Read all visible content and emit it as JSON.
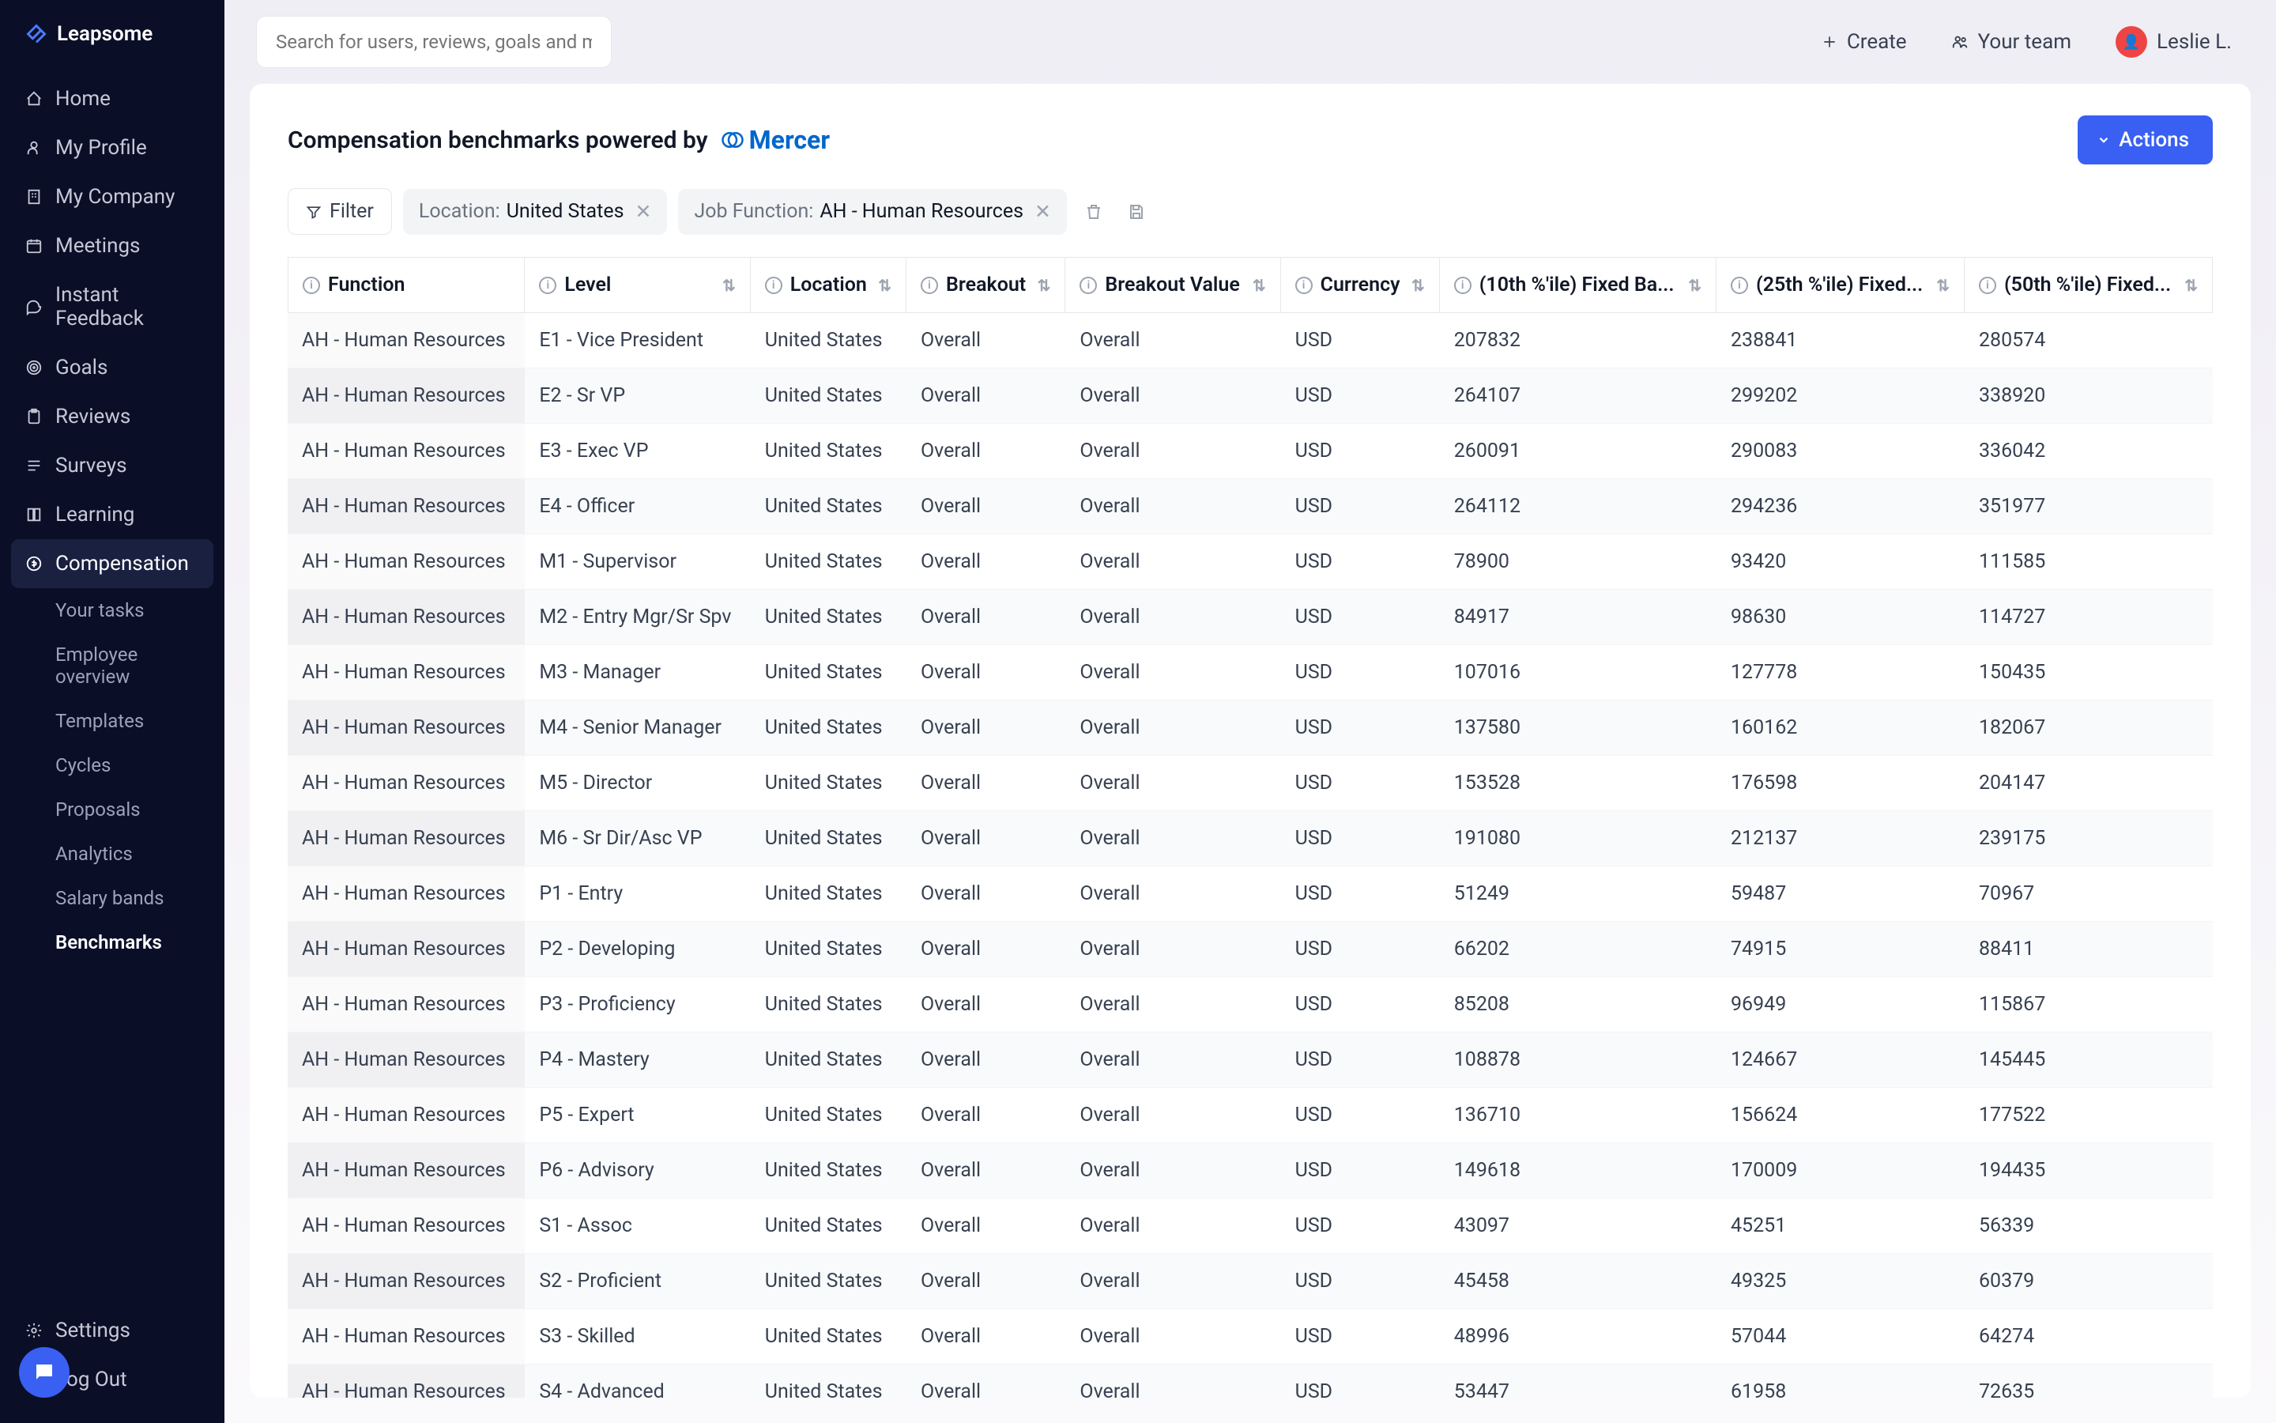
{
  "brand": "Leapsome",
  "search": {
    "placeholder": "Search for users, reviews, goals and meetings"
  },
  "topbar": {
    "create": "Create",
    "your_team": "Your team",
    "user_name": "Leslie L."
  },
  "sidebar": {
    "items": [
      {
        "label": "Home"
      },
      {
        "label": "My Profile"
      },
      {
        "label": "My Company"
      },
      {
        "label": "Meetings"
      },
      {
        "label": "Instant Feedback"
      },
      {
        "label": "Goals"
      },
      {
        "label": "Reviews"
      },
      {
        "label": "Surveys"
      },
      {
        "label": "Learning"
      },
      {
        "label": "Compensation",
        "active": true
      }
    ],
    "sub_items": [
      {
        "label": "Your tasks"
      },
      {
        "label": "Employee overview"
      },
      {
        "label": "Templates"
      },
      {
        "label": "Cycles"
      },
      {
        "label": "Proposals"
      },
      {
        "label": "Analytics"
      },
      {
        "label": "Salary bands"
      },
      {
        "label": "Benchmarks",
        "active": true
      }
    ],
    "bottom": [
      {
        "label": "Settings"
      },
      {
        "label": "Log Out"
      }
    ]
  },
  "page": {
    "title": "Compensation benchmarks powered by",
    "provider": "Mercer",
    "actions_label": "Actions"
  },
  "filters": {
    "filter_label": "Filter",
    "chips": [
      {
        "label": "Location:",
        "value": "United States"
      },
      {
        "label": "Job Function:",
        "value": "AH - Human Resources"
      }
    ]
  },
  "table": {
    "columns": [
      "Function",
      "Level",
      "Location",
      "Breakout",
      "Breakout Value",
      "Currency",
      "(10th %'ile) Fixed Ba...",
      "(25th %'ile) Fixed...",
      "(50th %'ile) Fixed..."
    ],
    "rows": [
      {
        "function": "AH - Human Resources",
        "level": "E1 - Vice President",
        "location": "United States",
        "breakout": "Overall",
        "breakout_value": "Overall",
        "currency": "USD",
        "p10": "207832",
        "p25": "238841",
        "p50": "280574"
      },
      {
        "function": "AH - Human Resources",
        "level": "E2 - Sr VP",
        "location": "United States",
        "breakout": "Overall",
        "breakout_value": "Overall",
        "currency": "USD",
        "p10": "264107",
        "p25": "299202",
        "p50": "338920"
      },
      {
        "function": "AH - Human Resources",
        "level": "E3 - Exec VP",
        "location": "United States",
        "breakout": "Overall",
        "breakout_value": "Overall",
        "currency": "USD",
        "p10": "260091",
        "p25": "290083",
        "p50": "336042"
      },
      {
        "function": "AH - Human Resources",
        "level": "E4 - Officer",
        "location": "United States",
        "breakout": "Overall",
        "breakout_value": "Overall",
        "currency": "USD",
        "p10": "264112",
        "p25": "294236",
        "p50": "351977"
      },
      {
        "function": "AH - Human Resources",
        "level": "M1 - Supervisor",
        "location": "United States",
        "breakout": "Overall",
        "breakout_value": "Overall",
        "currency": "USD",
        "p10": "78900",
        "p25": "93420",
        "p50": "111585"
      },
      {
        "function": "AH - Human Resources",
        "level": "M2 - Entry Mgr/Sr Spv",
        "location": "United States",
        "breakout": "Overall",
        "breakout_value": "Overall",
        "currency": "USD",
        "p10": "84917",
        "p25": "98630",
        "p50": "114727"
      },
      {
        "function": "AH - Human Resources",
        "level": "M3 - Manager",
        "location": "United States",
        "breakout": "Overall",
        "breakout_value": "Overall",
        "currency": "USD",
        "p10": "107016",
        "p25": "127778",
        "p50": "150435"
      },
      {
        "function": "AH - Human Resources",
        "level": "M4 - Senior Manager",
        "location": "United States",
        "breakout": "Overall",
        "breakout_value": "Overall",
        "currency": "USD",
        "p10": "137580",
        "p25": "160162",
        "p50": "182067"
      },
      {
        "function": "AH - Human Resources",
        "level": "M5 - Director",
        "location": "United States",
        "breakout": "Overall",
        "breakout_value": "Overall",
        "currency": "USD",
        "p10": "153528",
        "p25": "176598",
        "p50": "204147"
      },
      {
        "function": "AH - Human Resources",
        "level": "M6 - Sr Dir/Asc VP",
        "location": "United States",
        "breakout": "Overall",
        "breakout_value": "Overall",
        "currency": "USD",
        "p10": "191080",
        "p25": "212137",
        "p50": "239175"
      },
      {
        "function": "AH - Human Resources",
        "level": "P1 - Entry",
        "location": "United States",
        "breakout": "Overall",
        "breakout_value": "Overall",
        "currency": "USD",
        "p10": "51249",
        "p25": "59487",
        "p50": "70967"
      },
      {
        "function": "AH - Human Resources",
        "level": "P2 - Developing",
        "location": "United States",
        "breakout": "Overall",
        "breakout_value": "Overall",
        "currency": "USD",
        "p10": "66202",
        "p25": "74915",
        "p50": "88411"
      },
      {
        "function": "AH - Human Resources",
        "level": "P3 - Proficiency",
        "location": "United States",
        "breakout": "Overall",
        "breakout_value": "Overall",
        "currency": "USD",
        "p10": "85208",
        "p25": "96949",
        "p50": "115867"
      },
      {
        "function": "AH - Human Resources",
        "level": "P4 - Mastery",
        "location": "United States",
        "breakout": "Overall",
        "breakout_value": "Overall",
        "currency": "USD",
        "p10": "108878",
        "p25": "124667",
        "p50": "145445"
      },
      {
        "function": "AH - Human Resources",
        "level": "P5 - Expert",
        "location": "United States",
        "breakout": "Overall",
        "breakout_value": "Overall",
        "currency": "USD",
        "p10": "136710",
        "p25": "156624",
        "p50": "177522"
      },
      {
        "function": "AH - Human Resources",
        "level": "P6 - Advisory",
        "location": "United States",
        "breakout": "Overall",
        "breakout_value": "Overall",
        "currency": "USD",
        "p10": "149618",
        "p25": "170009",
        "p50": "194435"
      },
      {
        "function": "AH - Human Resources",
        "level": "S1 - Assoc",
        "location": "United States",
        "breakout": "Overall",
        "breakout_value": "Overall",
        "currency": "USD",
        "p10": "43097",
        "p25": "45251",
        "p50": "56339"
      },
      {
        "function": "AH - Human Resources",
        "level": "S2 - Proficient",
        "location": "United States",
        "breakout": "Overall",
        "breakout_value": "Overall",
        "currency": "USD",
        "p10": "45458",
        "p25": "49325",
        "p50": "60379"
      },
      {
        "function": "AH - Human Resources",
        "level": "S3 - Skilled",
        "location": "United States",
        "breakout": "Overall",
        "breakout_value": "Overall",
        "currency": "USD",
        "p10": "48996",
        "p25": "57044",
        "p50": "64274"
      },
      {
        "function": "AH - Human Resources",
        "level": "S4 - Advanced",
        "location": "United States",
        "breakout": "Overall",
        "breakout_value": "Overall",
        "currency": "USD",
        "p10": "53447",
        "p25": "61958",
        "p50": "72635"
      }
    ]
  }
}
